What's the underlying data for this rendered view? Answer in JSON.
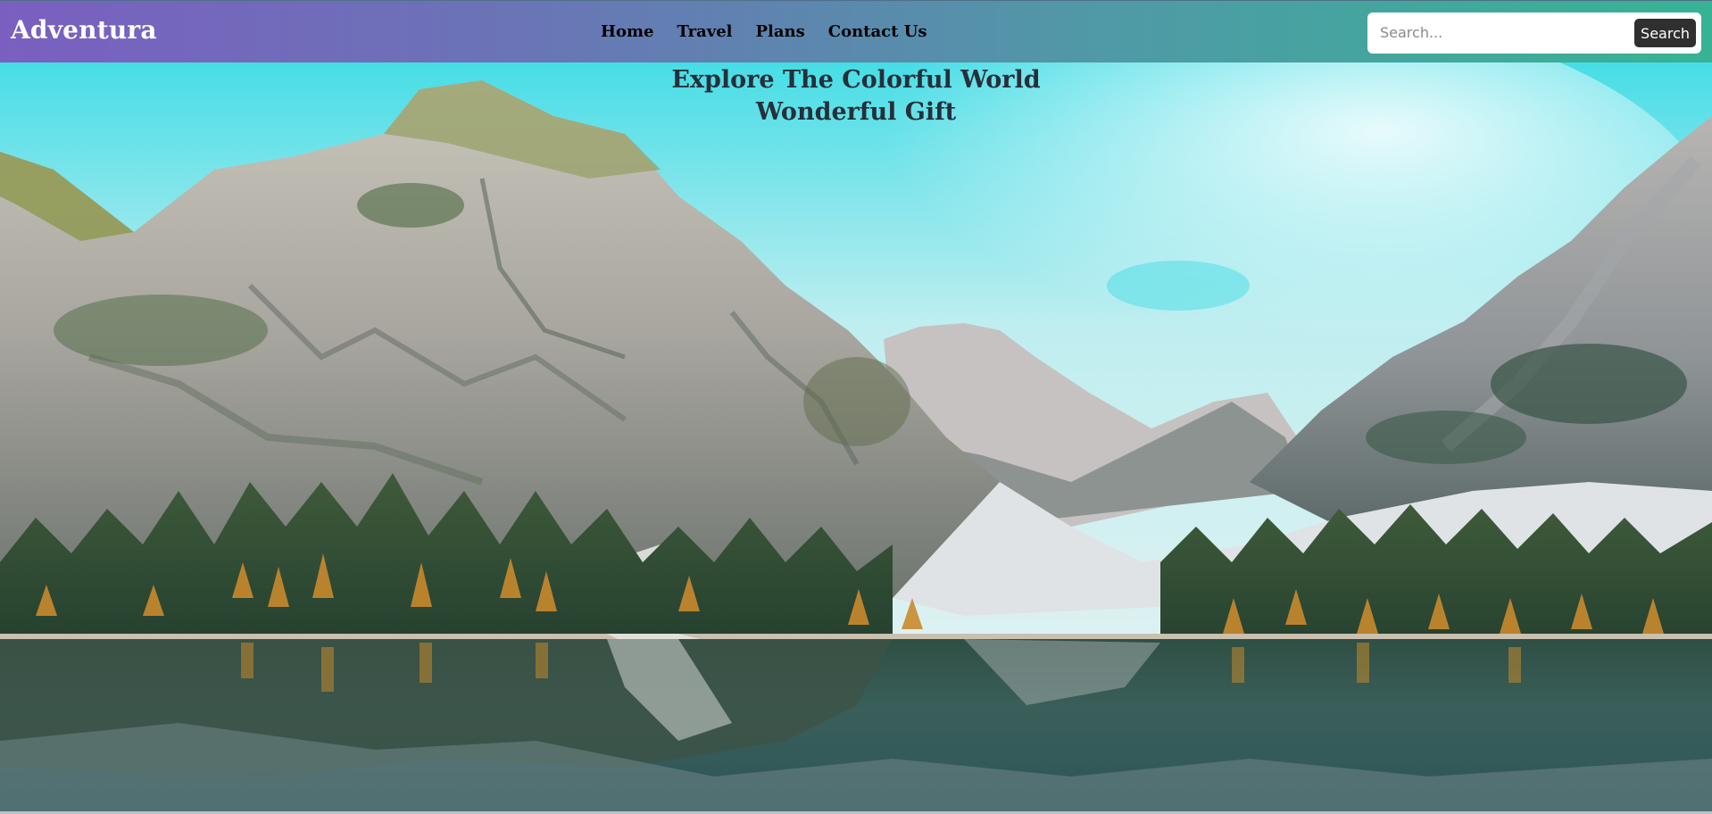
{
  "brand": {
    "name": "Adventura"
  },
  "nav": {
    "links": [
      "Home",
      "Travel",
      "Plans",
      "Contact Us"
    ]
  },
  "search": {
    "placeholder": "Search...",
    "value": "",
    "button_label": "Search"
  },
  "hero": {
    "headline_line1": "Explore The Colorful World",
    "headline_line2": "Wonderful Gift",
    "image": "mountain-lake-landscape"
  },
  "colors": {
    "navbar_gradient_start": "#7a5fc0",
    "navbar_gradient_end": "#37b394",
    "search_button": "#2f2f2f",
    "headline_text": "#262f3a"
  }
}
